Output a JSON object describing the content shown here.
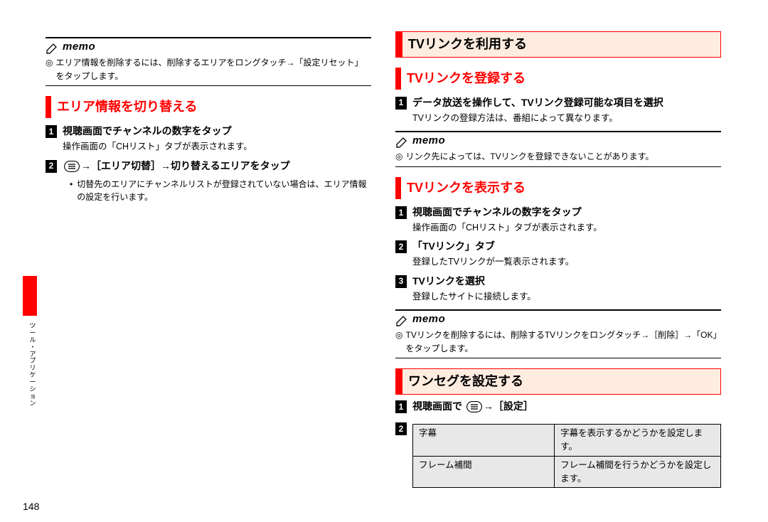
{
  "page_number": "148",
  "side_label": "ツール・アプリケーション",
  "memo_label": "memo",
  "menu_glyph": "≡",
  "left": {
    "memo1_items": [
      "エリア情報を削除するには、削除するエリアをロングタッチ→「設定リセット」をタップします。"
    ],
    "h_switch_area": "エリア情報を切り替える",
    "step1_title": "視聴画面でチャンネルの数字をタップ",
    "step1_desc": "操作画面の「CHリスト」タブが表示されます。",
    "step2_prefix": "",
    "step2_title_before": "",
    "step2_title_after": "→［エリア切替］→切り替えるエリアをタップ",
    "step2_note": "切替先のエリアにチャンネルリストが登録されていない場合は、エリア情報の設定を行います。"
  },
  "right": {
    "h_use_tvlink": "TVリンクを利用する",
    "h_register_tvlink": "TVリンクを登録する",
    "reg_step1_title": "データ放送を操作して、TVリンク登録可能な項目を選択",
    "reg_step1_desc": "TVリンクの登録方法は、番組によって異なります。",
    "memo2_items": [
      "リンク先によっては、TVリンクを登録できないことがあります。"
    ],
    "h_show_tvlink": "TVリンクを表示する",
    "show_step1_title": "視聴画面でチャンネルの数字をタップ",
    "show_step1_desc": "操作画面の「CHリスト」タブが表示されます。",
    "show_step2_title": "「TVリンク」タブ",
    "show_step2_desc": "登録したTVリンクが一覧表示されます。",
    "show_step3_title": "TVリンクを選択",
    "show_step3_desc": "登録したサイトに接続します。",
    "memo3_items": [
      "TVリンクを削除するには、削除するTVリンクをロングタッチ→［削除］→「OK」をタップします。"
    ],
    "h_oneseg_settings": "ワンセグを設定する",
    "oneseg_step1_before": "視聴画面で",
    "oneseg_step1_after": "→［設定］",
    "settings_table": [
      {
        "label": "字幕",
        "desc": "字幕を表示するかどうかを設定します。"
      },
      {
        "label": "フレーム補間",
        "desc": "フレーム補間を行うかどうかを設定します。"
      }
    ]
  }
}
